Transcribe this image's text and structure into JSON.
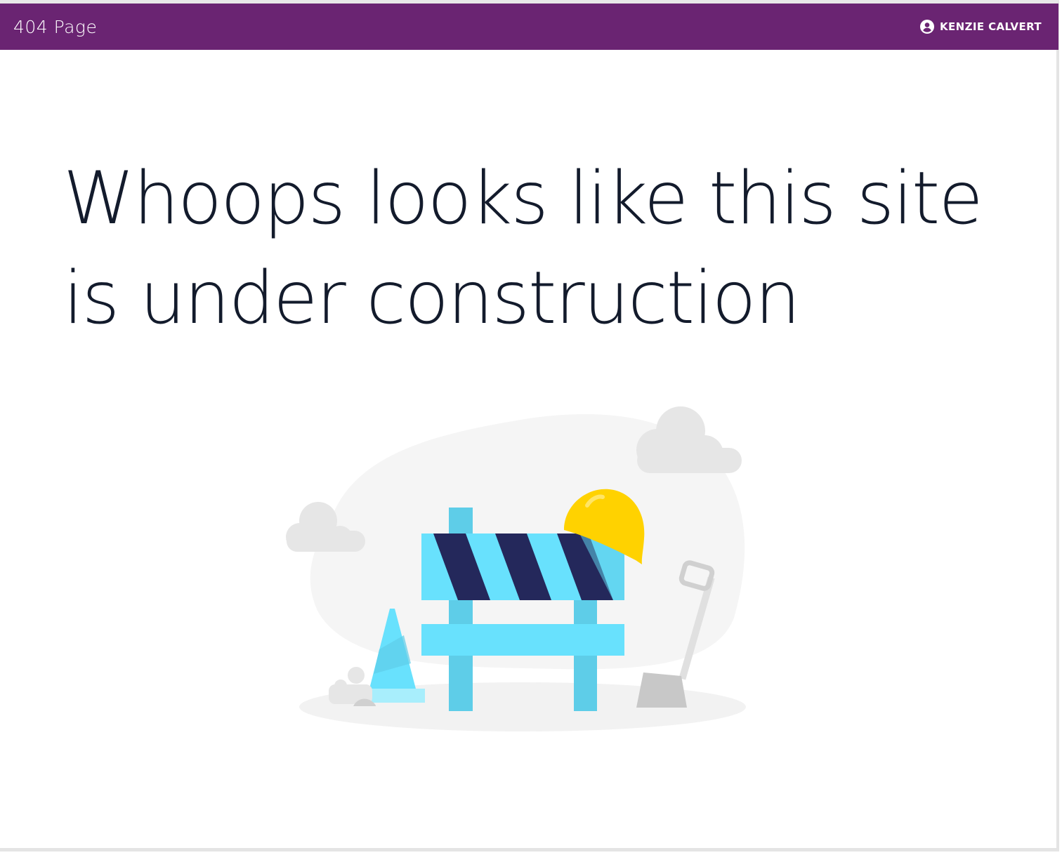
{
  "header": {
    "title": "404 Page",
    "user_name": "KENZIE CALVERT",
    "user_icon": "account-circle-icon",
    "background_color": "#6a2472"
  },
  "main": {
    "headline": "Whoops looks like this site is under construction",
    "illustration": {
      "description_icon": "construction-barrier-illustration",
      "colors": {
        "stripe_dark": "#24285b",
        "barrier_light": "#68e1fd",
        "barrier_post": "#5ecde8",
        "helmet": "#ffd200",
        "cloud": "#e6e6e6",
        "backdrop": "#f5f5f5"
      }
    }
  }
}
